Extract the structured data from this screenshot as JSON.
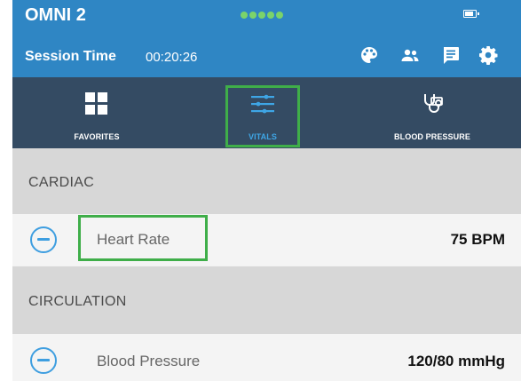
{
  "header": {
    "app_title": "OMNI 2",
    "session_label": "Session Time",
    "session_time": "00:20:26",
    "accent": "#2f86c4",
    "icons": [
      "palette-icon",
      "people-icon",
      "notes-icon",
      "settings-gear-icon"
    ]
  },
  "tabs": [
    {
      "label": "FAVORITES",
      "icon": "grid-icon",
      "active": false
    },
    {
      "label": "VITALS",
      "icon": "sliders-icon",
      "active": true
    },
    {
      "label": "BLOOD PRESSURE",
      "icon": "stethoscope-icon",
      "active": false
    }
  ],
  "sections": [
    {
      "title": "CARDIAC",
      "rows": [
        {
          "label": "Heart Rate",
          "value": "75 BPM",
          "icon": "minus-circle-icon"
        }
      ]
    },
    {
      "title": "CIRCULATION",
      "rows": [
        {
          "label": "Blood Pressure",
          "value": "120/80 mmHg",
          "icon": "minus-circle-icon"
        }
      ]
    }
  ],
  "colors": {
    "tabbar_bg": "#344b63",
    "active_tab": "#3ea6e6",
    "highlight": "#3fae49",
    "status_dots": "#7bd36a"
  }
}
